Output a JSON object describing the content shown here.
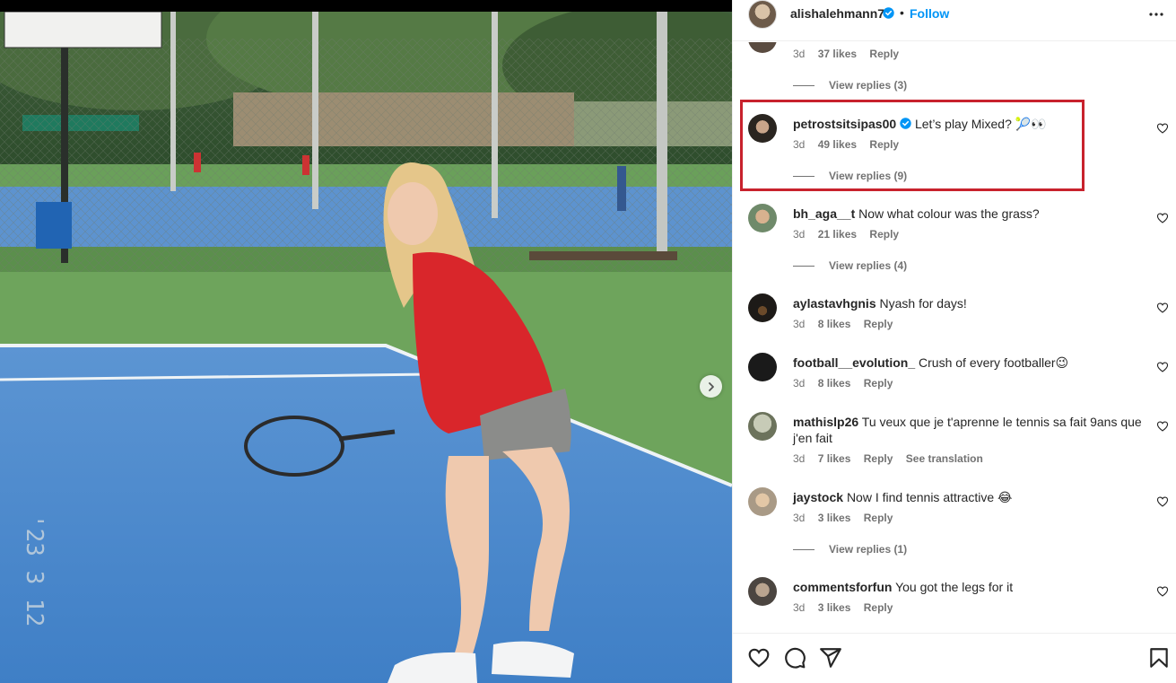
{
  "post": {
    "author": "alishalehmann7",
    "separator": "•",
    "follow_label": "Follow"
  },
  "comments": [
    {
      "meta": {
        "time": "3d",
        "likes": "37 likes",
        "reply": "Reply"
      },
      "view_replies": "View replies (3)"
    },
    {
      "user": "petrostsitsipas00",
      "text": "Let’s play Mixed? 🎾👀",
      "meta": {
        "time": "3d",
        "likes": "49 likes",
        "reply": "Reply"
      },
      "view_replies": "View replies (9)"
    },
    {
      "user": "bh_aga__t",
      "text": "Now what colour was the grass?",
      "meta": {
        "time": "3d",
        "likes": "21 likes",
        "reply": "Reply"
      },
      "view_replies": "View replies (4)"
    },
    {
      "user": "aylastavhgnis",
      "text": "Nyash for days!",
      "meta": {
        "time": "3d",
        "likes": "8 likes",
        "reply": "Reply"
      }
    },
    {
      "user": "football__evolution_",
      "text": "Crush of every footballer😉",
      "meta": {
        "time": "3d",
        "likes": "8 likes",
        "reply": "Reply"
      }
    },
    {
      "user": "mathislp26",
      "text": "Tu veux que je t'aprenne le tennis sa fait 9ans que j'en fait",
      "meta": {
        "time": "3d",
        "likes": "7 likes",
        "reply": "Reply",
        "translate": "See translation"
      }
    },
    {
      "user": "jaystock",
      "text": "Now I find tennis attractive 😂",
      "meta": {
        "time": "3d",
        "likes": "3 likes",
        "reply": "Reply"
      },
      "view_replies": "View replies (1)"
    },
    {
      "user": "commentsforfun",
      "text": "You got the legs for it",
      "meta": {
        "time": "3d",
        "likes": "3 likes",
        "reply": "Reply"
      }
    }
  ],
  "colors": {
    "link_blue": "#0095f6",
    "highlight_red": "#c8222d",
    "muted": "#737373"
  },
  "icons": [
    "verified-badge-icon",
    "more-options-icon",
    "heart-icon",
    "comment-icon",
    "share-icon",
    "bookmark-icon",
    "chevron-right-icon"
  ]
}
